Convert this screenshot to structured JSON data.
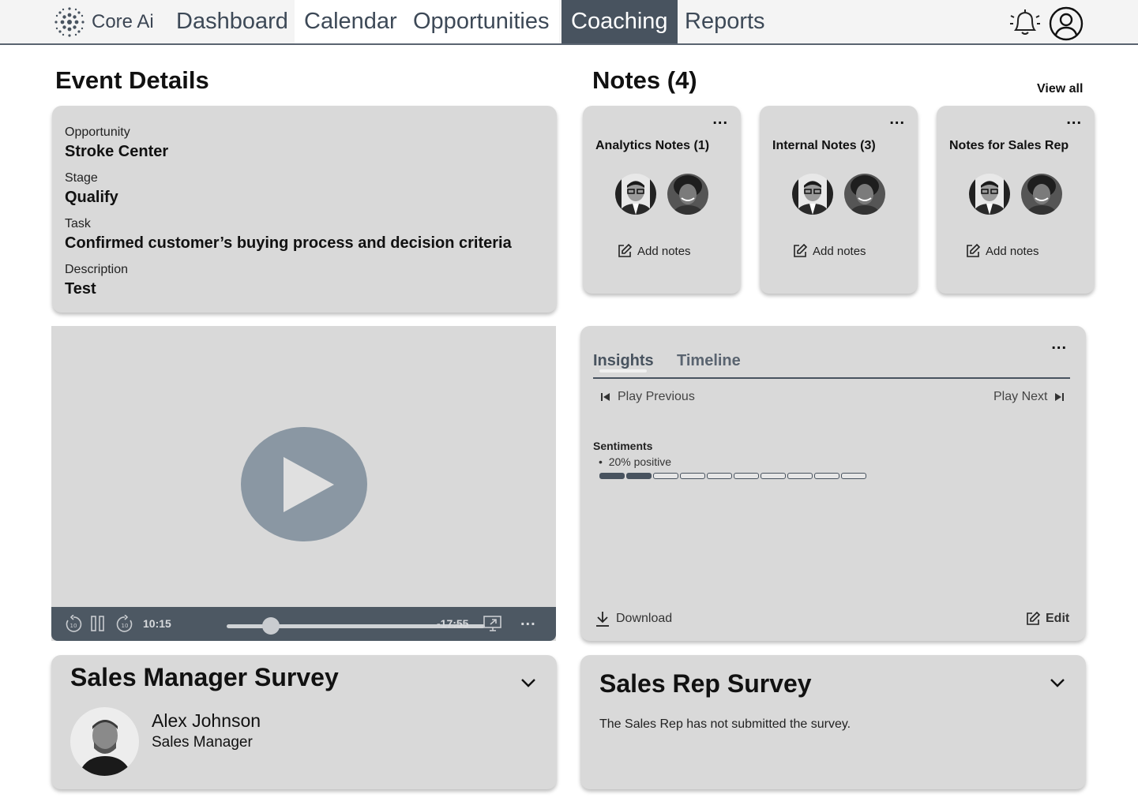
{
  "brand": {
    "name": "Core Ai"
  },
  "nav": {
    "items": [
      {
        "label": "Dashboard",
        "active": false
      },
      {
        "label": "Calendar",
        "active": false
      },
      {
        "label": "Opportunities",
        "active": false
      },
      {
        "label": "Coaching",
        "active": true
      },
      {
        "label": "Reports",
        "active": false
      }
    ],
    "icons": [
      "bell-icon",
      "user-icon"
    ]
  },
  "event_details": {
    "heading": "Event Details",
    "fields": [
      {
        "label": "Opportunity",
        "value": "Stroke Center"
      },
      {
        "label": "Stage",
        "value": "Qualify"
      },
      {
        "label": "Task",
        "value": "Confirmed customer’s buying process and decision criteria"
      },
      {
        "label": "Description",
        "value": "Test"
      }
    ]
  },
  "notes": {
    "heading": "Notes (4)",
    "view_all": "View all",
    "more": "...",
    "cards": [
      {
        "title": "Analytics Notes (1)",
        "add_label": "Add notes"
      },
      {
        "title": "Internal Notes (3)",
        "add_label": "Add notes"
      },
      {
        "title": "Notes for Sales Rep",
        "add_label": "Add notes"
      }
    ]
  },
  "player": {
    "elapsed": "10:15",
    "remaining": "-17:55",
    "progress": 0.17,
    "more": "..."
  },
  "insights": {
    "tabs": [
      {
        "label": "Insights",
        "active": true
      },
      {
        "label": "Timeline",
        "active": false
      }
    ],
    "more": "...",
    "play_previous": "Play Previous",
    "play_next": "Play Next",
    "sentiments_title": "Sentiments",
    "sentiment_item": "20% positive",
    "sentiment_fraction": 0.2,
    "sentiment_segments": 10,
    "download": "Download",
    "edit": "Edit"
  },
  "manager_survey": {
    "title": "Sales Manager Survey",
    "person_name": "Alex Johnson",
    "person_role": "Sales Manager"
  },
  "rep_survey": {
    "title": "Sales Rep Survey",
    "message": "The Sales Rep has not submitted the survey."
  },
  "colors": {
    "accent": "#48535f",
    "card": "#d9d9d9",
    "play_button": "#8a97a3",
    "nav_text": "#3d4957"
  }
}
